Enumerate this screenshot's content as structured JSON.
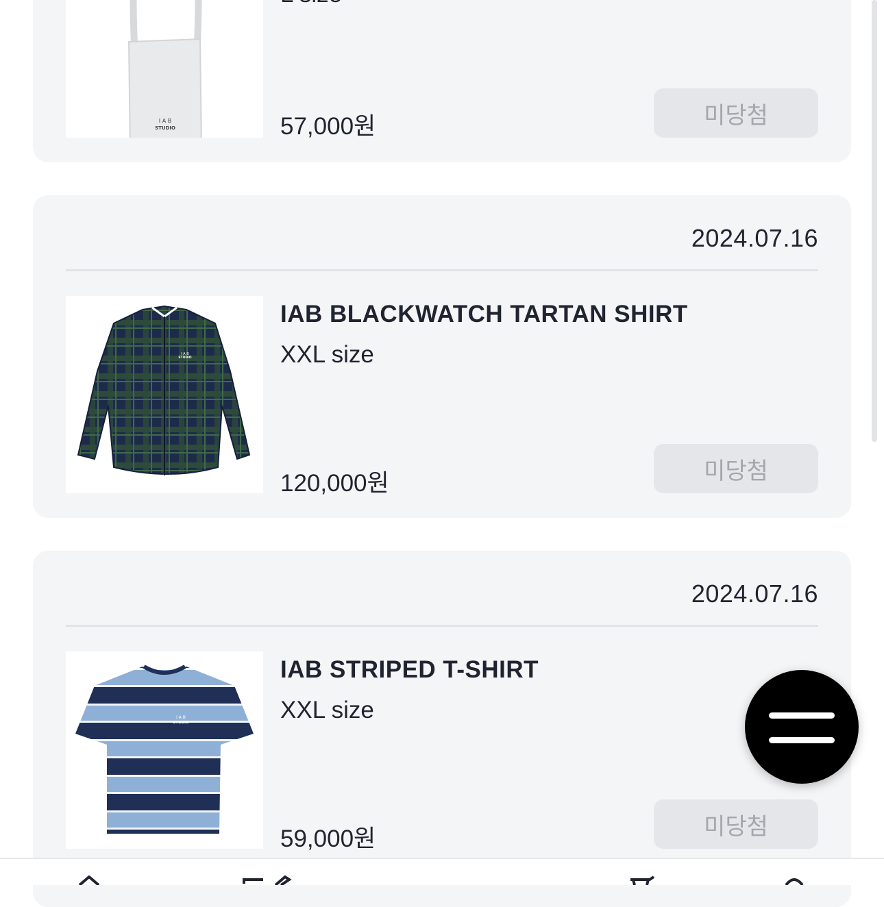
{
  "products": [
    {
      "size": "L size",
      "price": "57,000원",
      "status": "미당첨",
      "image_icon": "tote-bag-icon"
    },
    {
      "date": "2024.07.16",
      "name": "IAB BLACKWATCH TARTAN SHIRT",
      "size": "XXL size",
      "price": "120,000원",
      "status": "미당첨",
      "image_icon": "shirt-icon"
    },
    {
      "date": "2024.07.16",
      "name": "IAB STRIPED T-SHIRT",
      "size": "XXL size",
      "price": "59,000원",
      "status": "미당첨",
      "image_icon": "tshirt-icon"
    }
  ],
  "product_image_text": {
    "logo_letters": "I A B",
    "logo_word": "STUDIO"
  },
  "fab": {
    "icon": "menu-icon"
  },
  "bottom_nav": {
    "icons": [
      "home-icon",
      "edit-icon",
      "cart-icon",
      "user-icon"
    ]
  },
  "colors": {
    "card_bg": "#f4f5f7",
    "button_bg": "#e4e6ea",
    "button_text": "#a3a7ae",
    "text": "#1f2430",
    "fab_bg": "#000000"
  }
}
